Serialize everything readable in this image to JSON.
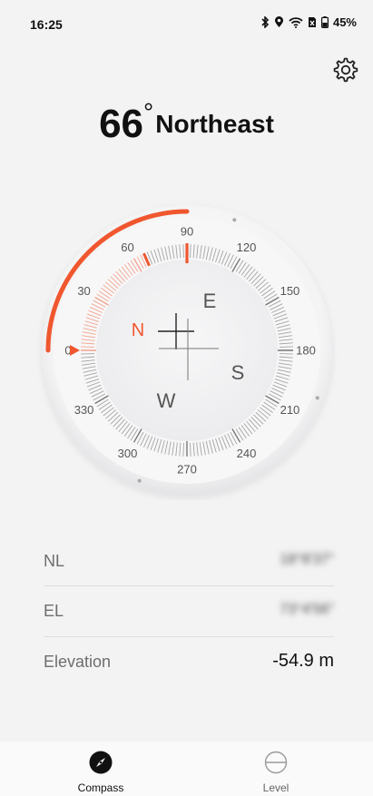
{
  "status_bar": {
    "time": "16:25",
    "battery_percent": "45%",
    "icons": [
      "bluetooth-icon",
      "location-icon",
      "wifi-icon",
      "no-sim-icon",
      "battery-icon"
    ]
  },
  "settings": {
    "icon": "gear-icon"
  },
  "heading": {
    "degrees": "66",
    "degree_symbol": "°",
    "direction": "Northeast"
  },
  "compass": {
    "heading_deg": 66,
    "cardinals": {
      "N": "N",
      "E": "E",
      "S": "S",
      "W": "W"
    },
    "degree_labels": [
      "0",
      "30",
      "60",
      "90",
      "120",
      "150",
      "180",
      "210",
      "240",
      "270",
      "300",
      "330"
    ],
    "colors": {
      "accent": "#f0572f",
      "tick": "#9a9a9a",
      "text": "#555555"
    }
  },
  "info": {
    "latitude": {
      "label": "NL",
      "value": "18°8'37\""
    },
    "longitude": {
      "label": "EL",
      "value": "73°4'56\""
    },
    "elevation": {
      "label": "Elevation",
      "value": "-54.9 m"
    }
  },
  "nav": {
    "compass_label": "Compass",
    "level_label": "Level"
  }
}
